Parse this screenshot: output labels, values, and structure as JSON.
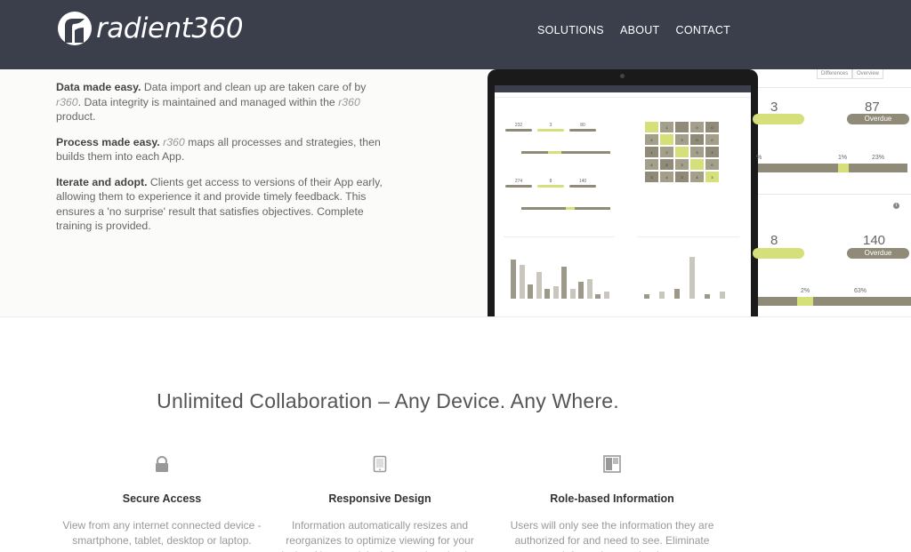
{
  "header": {
    "logo_text": "radient360",
    "nav": [
      "SOLUTIONS",
      "ABOUT",
      "CONTACT"
    ]
  },
  "hero": {
    "paragraphs": [
      {
        "lead": "Data made easy.",
        "text_a": " Data import and clean up are taken care of by ",
        "brand_a": "r360",
        "text_b": ". Data integrity is maintained and managed within the ",
        "brand_b": "r360",
        "text_c": " product."
      },
      {
        "lead": "Process made easy.",
        "text_a": " ",
        "brand_a": "r360",
        "text_b": " maps all processes and strategies, then builds them into each App."
      },
      {
        "lead": "Iterate and adopt.",
        "text_a": " Clients get access to versions of their App early, allowing them to experience it and provide timely feedback. This ensures a 'no surprise' result that satisfies objectives. Complete training is provided."
      }
    ]
  },
  "tablet": {
    "panel1_stats": [
      "232",
      "3",
      "80"
    ],
    "panel2_stats": [
      "274",
      "8",
      "140"
    ],
    "matrix": [
      [
        "",
        "1",
        "",
        "0",
        "0"
      ],
      [
        "4",
        "",
        "3",
        "0",
        "0"
      ],
      [
        "1",
        "2",
        "",
        "3",
        "4"
      ],
      [
        "4",
        "6",
        "3",
        "",
        "0"
      ],
      [
        "3",
        "4",
        "3",
        "4",
        "3"
      ]
    ],
    "chart_bars_left": [
      0.8,
      0.7,
      0.3,
      0.55,
      0.2,
      0.25,
      0.65,
      0.2,
      0.35,
      0.4,
      0.1,
      0.15
    ],
    "chart_bars_right": [
      0.1,
      0.15,
      0.2,
      0.85,
      0.1,
      0.15
    ]
  },
  "dashboard": {
    "tabs": [
      "Differences",
      "Overview"
    ],
    "block1": {
      "value_a": "3",
      "value_b": "87",
      "pill_b": "Overdue",
      "pct_a": "%",
      "pct_b": "1%",
      "pct_c": "23%"
    },
    "block2": {
      "value_a": "8",
      "value_b": "140",
      "pill_b": "Overdue",
      "pct_a": "2%",
      "pct_b": "63%"
    }
  },
  "collab": {
    "title": "Unlimited Collaboration – Any Device. Any Where.",
    "features": [
      {
        "title": "Secure Access",
        "text": "View from any internet connected device - smartphone, tablet, desktop or laptop."
      },
      {
        "title": "Responsive Design",
        "text": "Information automatically resizes and reorganizes to optimize viewing for your device. No more 'pinch & zoom' navigation."
      },
      {
        "title": "Role-based Information",
        "text": "Users will only see the information they are authorized for and need to see. Eliminate information overload."
      }
    ]
  },
  "colors": {
    "header_bg": "#3a3f4b",
    "accent_green": "#d6e07b",
    "accent_taupe": "#8f8b78"
  }
}
